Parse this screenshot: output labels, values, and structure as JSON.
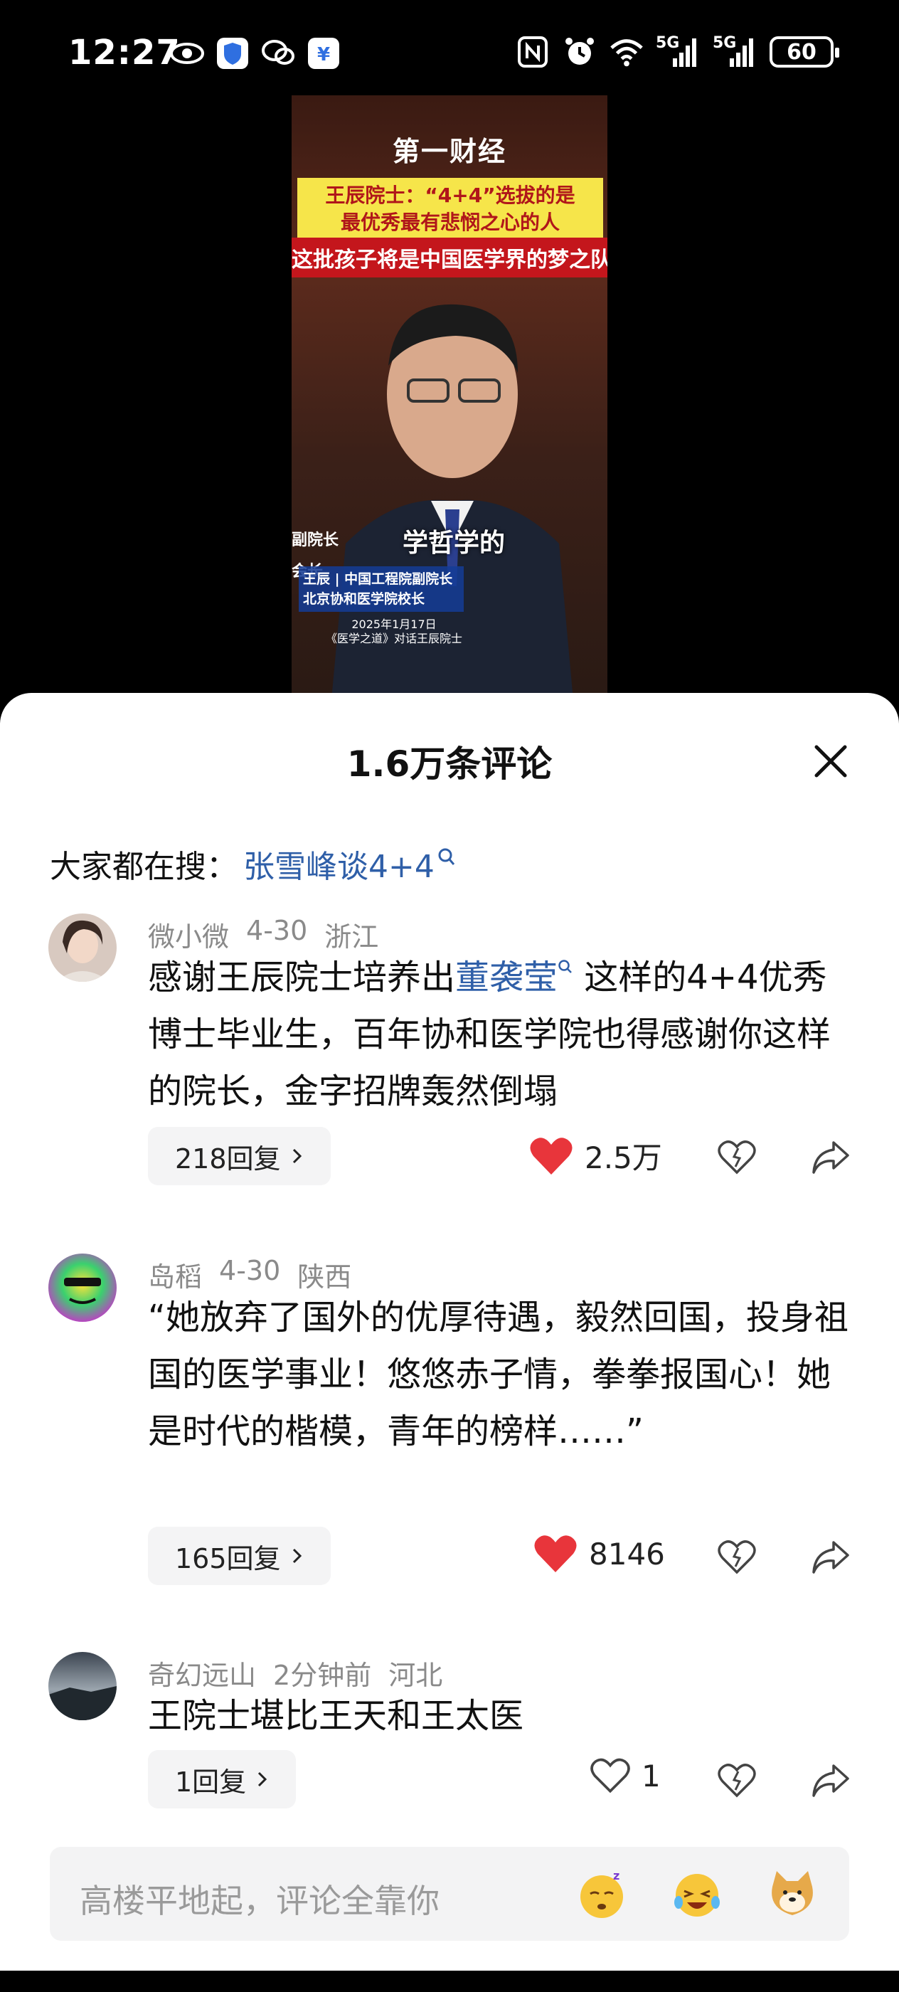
{
  "status_bar": {
    "time": "12:27",
    "battery": "60",
    "signal_labels": [
      "5G",
      "5G"
    ]
  },
  "video": {
    "logo": "第一财经",
    "title_line1": "王辰院士：“4+4”选拔的是",
    "title_line2": "最优秀最有悲悯之心的人",
    "subtitle": "这批孩子将是中国医学界的梦之队",
    "caption": "学哲学的",
    "name_left_1": "副院长",
    "name_left_2": "会长",
    "name_line1": "王辰 | 中国工程院副院长",
    "name_line2": "北京协和医学院校长",
    "date_line1": "2025年1月17日",
    "date_line2": "《医学之道》对话王辰院士"
  },
  "sheet": {
    "title": "1.6万条评论",
    "search_prefix": "大家都在搜：",
    "search_keyword": "张雪峰谈4+4"
  },
  "comments": [
    {
      "user": "微小微",
      "date": "4-30",
      "location": "浙江",
      "text_before": "感谢王辰院士培养出",
      "mention": "董袭莹",
      "text_after": " 这样的4+4优秀博士毕业生，百年协和医学院也得感谢你这样的院长，金字招牌轰然倒塌",
      "replies": "218回复",
      "likes": "2.5万",
      "liked": true
    },
    {
      "user": "岛稻",
      "date": "4-30",
      "location": "陕西",
      "text": "“她放弃了国外的优厚待遇，毅然回国，投身祖国的医学事业！悠悠赤子情，拳拳报国心！她是时代的楷模，青年的榜样……”",
      "replies": "165回复",
      "likes": "8146",
      "liked": true
    },
    {
      "user": "奇幻远山",
      "date": "2分钟前",
      "location": "河北",
      "text": "王院士堪比王天和王太医",
      "replies": "1回复",
      "likes": "1",
      "liked": false
    }
  ],
  "input": {
    "placeholder": "高楼平地起，评论全靠你"
  },
  "colors": {
    "accent_blue": "#2f5fa8",
    "like_red": "#e8353b",
    "meta_gray": "#8a8a8a"
  }
}
